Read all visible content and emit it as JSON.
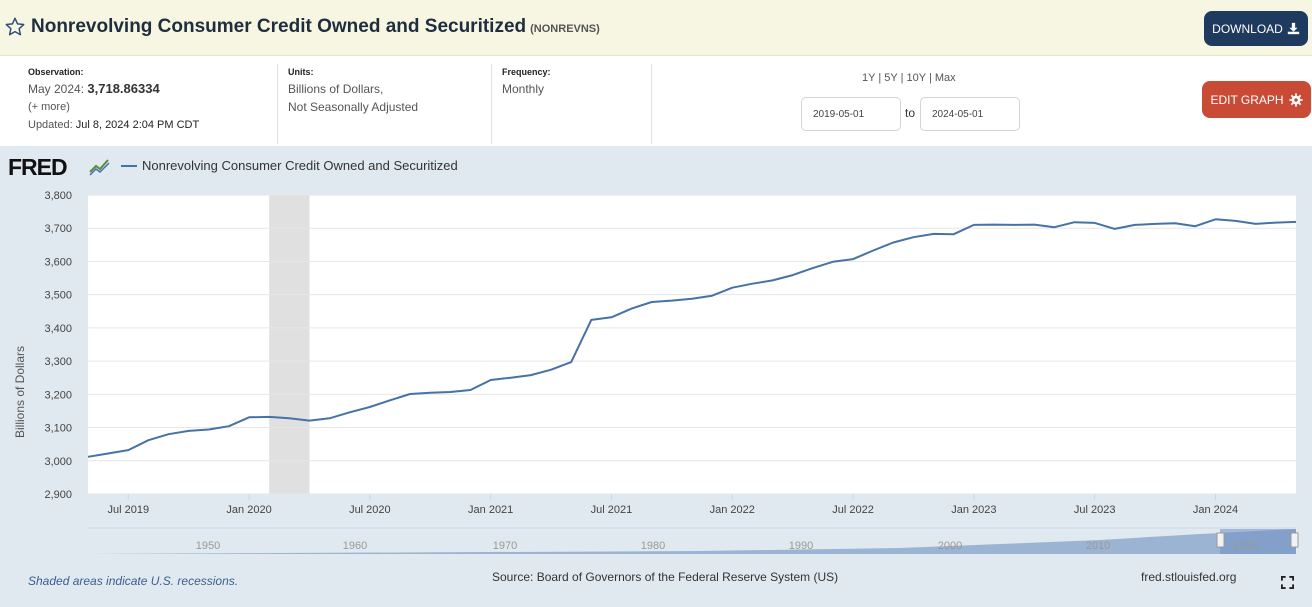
{
  "header": {
    "title": "Nonrevolving Consumer Credit Owned and Securitized",
    "series_id": "(NONREVNS)",
    "download_label": "DOWNLOAD"
  },
  "meta": {
    "observation_label": "Observation:",
    "observation_period": "May 2024:",
    "observation_value": "3,718.86334",
    "more": "(+ more)",
    "updated_label": "Updated:",
    "updated_value": "Jul 8, 2024 2:04 PM CDT",
    "units_label": "Units:",
    "units_line1": "Billions of Dollars,",
    "units_line2": "Not Seasonally Adjusted",
    "frequency_label": "Frequency:",
    "frequency_value": "Monthly"
  },
  "range": {
    "r1y": "1Y",
    "r5y": "5Y",
    "r10y": "10Y",
    "rmax": "Max",
    "sep": "|",
    "start_date": "2019-05-01",
    "to": "to",
    "end_date": "2024-05-01"
  },
  "edit_label": "EDIT GRAPH",
  "brand": {
    "logo": "FRED",
    "accent": "#4572a7",
    "download_color": "#1f3a5f",
    "edit_color": "#c94b36"
  },
  "footer": {
    "recession_note": "Shaded areas indicate U.S. recessions.",
    "source": "Source: Board of Governors of the Federal Reserve System (US)",
    "site": "fred.stlouisfed.org"
  },
  "navigator": {
    "years": [
      "1950",
      "1960",
      "1970",
      "1980",
      "1990",
      "2000",
      "2010",
      "2020"
    ]
  },
  "chart_data": {
    "type": "line",
    "ylabel": "Billions of Dollars",
    "ylim": [
      2900,
      3800
    ],
    "yticks": [
      "2,900",
      "3,000",
      "3,100",
      "3,200",
      "3,300",
      "3,400",
      "3,500",
      "3,600",
      "3,700",
      "3,800"
    ],
    "xticks": [
      "Jul 2019",
      "Jan 2020",
      "Jul 2020",
      "Jan 2021",
      "Jul 2021",
      "Jan 2022",
      "Jul 2022",
      "Jan 2023",
      "Jul 2023",
      "Jan 2024"
    ],
    "recession": [
      "2020-02",
      "2020-04"
    ],
    "grid": true,
    "series": [
      {
        "name": "Nonrevolving Consumer Credit Owned and Securitized",
        "x": [
          "2019-05",
          "2019-06",
          "2019-07",
          "2019-08",
          "2019-09",
          "2019-10",
          "2019-11",
          "2019-12",
          "2020-01",
          "2020-02",
          "2020-03",
          "2020-04",
          "2020-05",
          "2020-06",
          "2020-07",
          "2020-08",
          "2020-09",
          "2020-10",
          "2020-11",
          "2020-12",
          "2021-01",
          "2021-02",
          "2021-03",
          "2021-04",
          "2021-05",
          "2021-06",
          "2021-07",
          "2021-08",
          "2021-09",
          "2021-10",
          "2021-11",
          "2021-12",
          "2022-01",
          "2022-02",
          "2022-03",
          "2022-04",
          "2022-05",
          "2022-06",
          "2022-07",
          "2022-08",
          "2022-09",
          "2022-10",
          "2022-11",
          "2022-12",
          "2023-01",
          "2023-02",
          "2023-03",
          "2023-04",
          "2023-05",
          "2023-06",
          "2023-07",
          "2023-08",
          "2023-09",
          "2023-10",
          "2023-11",
          "2023-12",
          "2024-01",
          "2024-02",
          "2024-03",
          "2024-04",
          "2024-05"
        ],
        "values": [
          3012,
          3022,
          3032,
          3062,
          3080,
          3090,
          3094,
          3104,
          3131,
          3132,
          3128,
          3121,
          3128,
          3146,
          3162,
          3182,
          3201,
          3205,
          3207,
          3213,
          3243,
          3250,
          3258,
          3274,
          3297,
          3424,
          3432,
          3458,
          3478,
          3482,
          3488,
          3497,
          3521,
          3533,
          3543,
          3559,
          3580,
          3599,
          3607,
          3633,
          3657,
          3673,
          3683,
          3682,
          3710,
          3711,
          3710,
          3711,
          3703,
          3718,
          3716,
          3698,
          3710,
          3713,
          3715,
          3706,
          3727,
          3722,
          3713,
          3717,
          3719
        ]
      }
    ]
  }
}
